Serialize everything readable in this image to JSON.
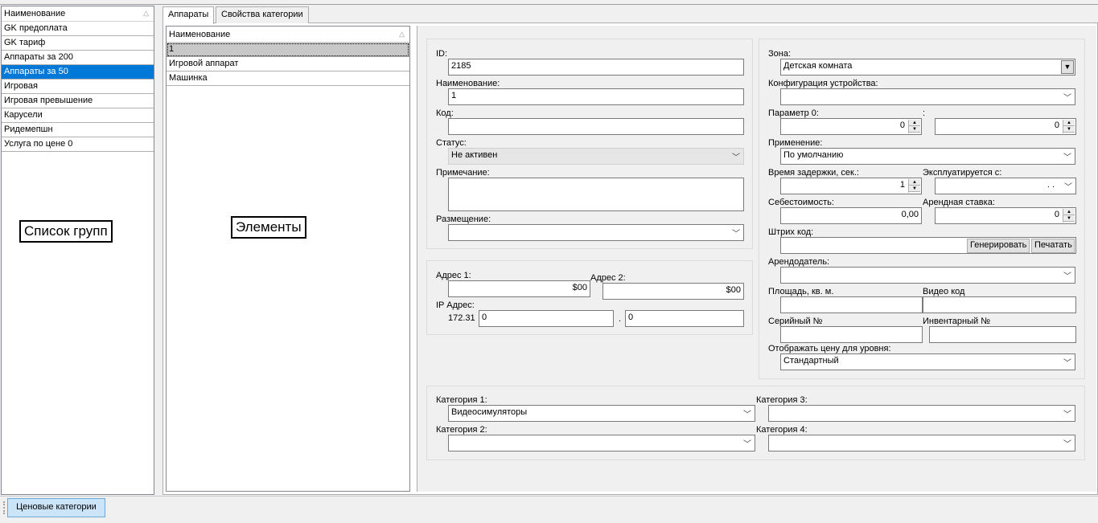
{
  "groups": {
    "header": "Наименование",
    "items": [
      "GK  предоплата",
      "GK тариф",
      "Аппараты за 200",
      "Аппараты за 50",
      "Игровая",
      "Игровая превышение",
      "Карусели",
      "Ридемепшн",
      "Услуга по цене 0"
    ],
    "selected_index": 3
  },
  "annotations": {
    "groups": "Список групп",
    "elements": "Элементы"
  },
  "tabs": [
    "Аппараты",
    "Свойства категории"
  ],
  "elements": {
    "header": "Наименование",
    "items": [
      "1",
      "Игровой аппарат",
      "Машинка"
    ]
  },
  "form": {
    "id_label": "ID:",
    "id_value": "2185",
    "name_label": "Наименование:",
    "name_value": "1",
    "code_label": "Код:",
    "code_value": "",
    "status_label": "Статус:",
    "status_value": "Не активен",
    "note_label": "Примечание:",
    "placement_label": "Размещение:",
    "placement_value": "",
    "addr1_label": "Адрес 1:",
    "addr1_value": "$00",
    "addr2_label": "Адрес 2:",
    "addr2_value": "$00",
    "ip_label": "IP Адрес:",
    "ip_prefix": "172.31",
    "ip_part3": "0",
    "ip_dot": ".",
    "ip_part4": "0",
    "zone_label": "Зона:",
    "zone_value": "Детская комната",
    "config_label": "Конфигурация устройства:",
    "config_value": "",
    "param0_label": "Параметр 0:",
    "param0_value": "0",
    "param_colon": ":",
    "param1_value": "0",
    "apply_label": "Применение:",
    "apply_value": "По умолчанию",
    "delay_label": "Время задержки, сек.:",
    "delay_value": "1",
    "exploit_label": "Эксплуатируется с:",
    "exploit_value": ". .",
    "cost_label": "Себестоимость:",
    "cost_value": "0,00",
    "rent_label": "Арендная ставка:",
    "rent_value": "0",
    "barcode_label": "Штрих код:",
    "barcode_value": "",
    "generate_btn": "Генерировать",
    "print_btn": "Печатать",
    "landlord_label": "Арендодатель:",
    "landlord_value": "",
    "area_label": "Площадь, кв. м.",
    "area_value": "",
    "video_label": "Видео код",
    "video_value": "",
    "serial_label": "Серийный №",
    "serial_value": "",
    "inventory_label": "Инвентарный №",
    "inventory_value": "",
    "pricelevel_label": "Отображать цену для уровня:",
    "pricelevel_value": "Стандартный",
    "cat1_label": "Категория 1:",
    "cat1_value": "Видеосимуляторы",
    "cat2_label": "Категория 2:",
    "cat2_value": "",
    "cat3_label": "Категория 3:",
    "cat3_value": "",
    "cat4_label": "Категория 4:",
    "cat4_value": ""
  },
  "statusbar": {
    "button": "Ценовые категории"
  }
}
